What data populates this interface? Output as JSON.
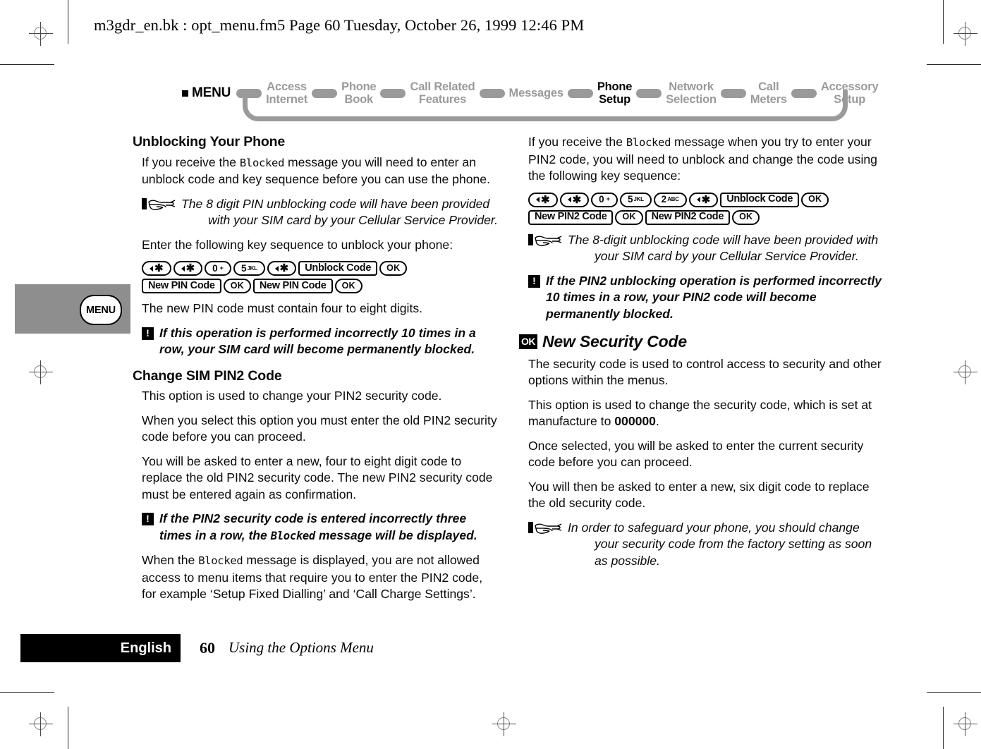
{
  "header": {
    "text": "m3gdr_en.bk : opt_menu.fm5  Page 60  Tuesday, October 26, 1999  12:46 PM"
  },
  "nav": {
    "menu_label": "MENU",
    "items": [
      {
        "line1": "Access",
        "line2": "Internet",
        "active": false
      },
      {
        "line1": "Phone",
        "line2": "Book",
        "active": false
      },
      {
        "line1": "Call Related",
        "line2": "Features",
        "active": false
      },
      {
        "line1": "Messages",
        "line2": "",
        "active": false
      },
      {
        "line1": "Phone",
        "line2": "Setup",
        "active": true
      },
      {
        "line1": "Network",
        "line2": "Selection",
        "active": false
      },
      {
        "line1": "Call",
        "line2": "Meters",
        "active": false
      },
      {
        "line1": "Accessory",
        "line2": "Setup",
        "active": false
      }
    ]
  },
  "side_tab": {
    "label": "MENU"
  },
  "left_column": {
    "heading1": "Unblocking Your Phone",
    "para1_a": "If you receive the ",
    "para1_code": "Blocked",
    "para1_b": " message you will need to enter an unblock code and key sequence before you can use the phone.",
    "note1": "The 8 digit PIN unblocking code will have been provided with your SIM card by your Cellular Service Provider.",
    "para2": "Enter the following key sequence to unblock your phone:",
    "keyseq1": {
      "row1": [
        {
          "type": "star",
          "label": "*"
        },
        {
          "type": "star",
          "label": "*"
        },
        {
          "type": "num",
          "label": "0",
          "sub": "+"
        },
        {
          "type": "num",
          "label": "5",
          "sub": "JKL"
        },
        {
          "type": "star",
          "label": "*"
        },
        {
          "type": "rect",
          "label": "Unblock Code"
        },
        {
          "type": "ok",
          "label": "OK"
        }
      ],
      "row2": [
        {
          "type": "rect",
          "label": "New PIN Code"
        },
        {
          "type": "ok",
          "label": "OK"
        },
        {
          "type": "rect",
          "label": "New PIN Code"
        },
        {
          "type": "ok",
          "label": "OK"
        }
      ]
    },
    "para3": "The new PIN code must contain four to eight digits.",
    "warn1": "If this operation is performed incorrectly 10 times in a row, your SIM card will become permanently blocked.",
    "heading2": "Change SIM PIN2 Code",
    "para4": "This option is used to change your PIN2 security code.",
    "para5": "When you select this option you must enter the old PIN2 security code before you can proceed.",
    "para6": "You will be asked to enter a new, four to eight digit code to replace the old PIN2 security code. The new PIN2 security code must be entered again as confirmation.",
    "warn2_a": "If the PIN2 security code is entered incorrectly three times in a row, the ",
    "warn2_code": "Blocked",
    "warn2_b": " message will be displayed.",
    "para7_a": "When the ",
    "para7_code": "Blocked",
    "para7_b": " message is displayed, you are not allowed access to menu items that require you to enter the PIN2 code, for example ‘Setup Fixed Dialling’ and ‘Call Charge Settings’."
  },
  "right_column": {
    "para1_a": "If you receive the ",
    "para1_code": "Blocked",
    "para1_b": " message when you try to enter your PIN2 code, you will need to unblock and change the code using the following key sequence:",
    "keyseq1": {
      "row1": [
        {
          "type": "star",
          "label": "*"
        },
        {
          "type": "star",
          "label": "*"
        },
        {
          "type": "num",
          "label": "0",
          "sub": "+"
        },
        {
          "type": "num",
          "label": "5",
          "sub": "JKL"
        },
        {
          "type": "num",
          "label": "2",
          "sub": "ABC"
        },
        {
          "type": "star",
          "label": "*"
        },
        {
          "type": "rect",
          "label": "Unblock Code"
        },
        {
          "type": "ok",
          "label": "OK"
        }
      ],
      "row2": [
        {
          "type": "rect",
          "label": "New PIN2 Code"
        },
        {
          "type": "ok",
          "label": "OK"
        },
        {
          "type": "rect",
          "label": "New PIN2 Code"
        },
        {
          "type": "ok",
          "label": "OK"
        }
      ]
    },
    "note1": "The 8-digit unblocking code will have been provided with your SIM card by your Cellular Service Provider.",
    "warn1": "If the PIN2 unblocking operation is performed incorrectly 10 times in a row, your PIN2 code will become permanently blocked.",
    "heading_icon": "OK",
    "heading1": "New Security Code",
    "para2": "The security code is used to control access to security and other options within the menus.",
    "para3_a": "This option is used to change the security code, which is set at manufacture to ",
    "para3_bold": "000000",
    "para3_b": ".",
    "para4": "Once selected, you will be asked to enter the current security code before you can proceed.",
    "para5": "You will then be asked to enter a new, six digit code to replace the old security code.",
    "note2": "In order to safeguard your phone, you should change your security code from the factory setting as soon as possible."
  },
  "footer": {
    "language": "English",
    "page_number": "60",
    "title": "Using the Options Menu"
  }
}
